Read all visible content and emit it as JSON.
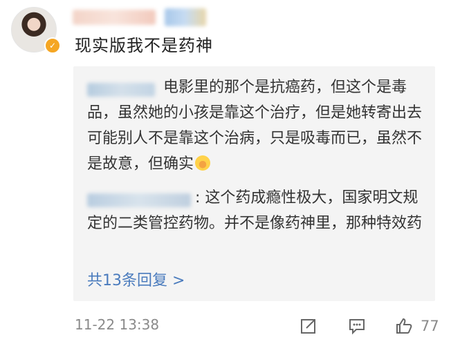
{
  "post": {
    "text": "现实版我不是药神"
  },
  "comments": {
    "reply1_text": "电影里的那个是抗癌药，但这个是毒品，虽然她的小孩是靠这个治疗，但是她转寄出去可能别人不是靠这个治病，只是吸毒而已，虽然不是故意，但确实",
    "reply2_text": ": 这个药成瘾性极大，国家明文规定的二类管控药物。并不是像药神里，那种特效药",
    "more_label": "共13条回复 >"
  },
  "footer": {
    "time": "11-22 13:38",
    "likes": "77"
  },
  "colors": {
    "link": "#4a7bbd",
    "muted": "#8a8a8a",
    "box": "#f4f4f4",
    "verified": "#f5a623"
  },
  "icons": {
    "verified": "verified-badge-icon",
    "share": "share-icon",
    "comment": "comment-icon",
    "like": "like-icon",
    "emoji": "laughing-crying-emoji-icon"
  }
}
